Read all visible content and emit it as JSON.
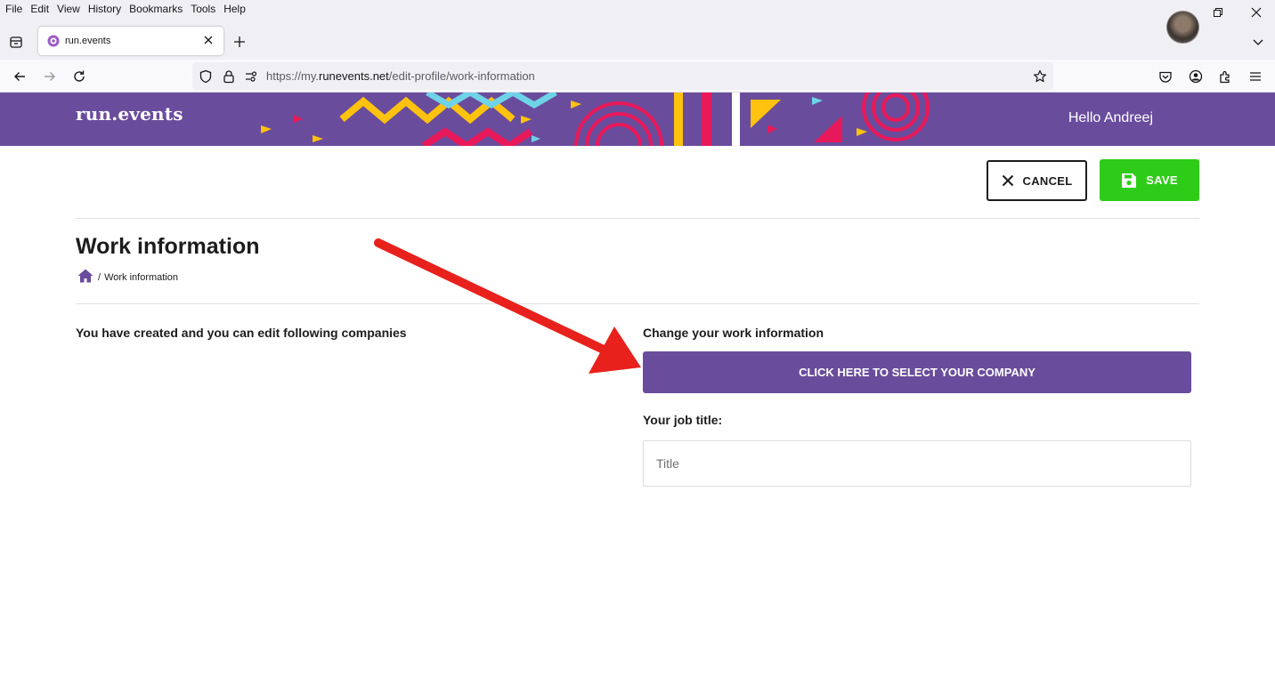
{
  "browser": {
    "menu": [
      "File",
      "Edit",
      "View",
      "History",
      "Bookmarks",
      "Tools",
      "Help"
    ],
    "tab_title": "run.events",
    "url_prefix": "https://my.",
    "url_host": "runevents.net",
    "url_path": "/edit-profile/work-information",
    "icons": [
      "tab-list-icon",
      "favicon-icon",
      "close-tab-icon",
      "new-tab-icon",
      "list-all-tabs-icon",
      "back-icon",
      "forward-icon",
      "reload-icon",
      "shield-icon",
      "lock-icon",
      "permissions-icon",
      "bookmark-star-icon",
      "pocket-icon",
      "account-icon",
      "extensions-icon",
      "app-menu-icon",
      "minimize-icon",
      "restore-icon",
      "close-window-icon"
    ]
  },
  "header": {
    "logo": "run.events",
    "greeting": "Hello Andreej",
    "colors": {
      "brand_purple": "#6a4c9c",
      "yellow": "#ffc20e",
      "pink": "#e8195a",
      "cyan": "#6fd3e8"
    }
  },
  "toolbar": {
    "cancel_label": "CANCEL",
    "save_label": "SAVE",
    "save_color": "#2ecc18"
  },
  "page": {
    "title": "Work information",
    "breadcrumb_separator": "/",
    "breadcrumb_current": "Work information"
  },
  "left": {
    "heading": "You have created and you can edit following companies"
  },
  "right": {
    "heading": "Change your work information",
    "select_company_label": "CLICK HERE TO SELECT YOUR COMPANY",
    "job_title_label": "Your job title:",
    "job_title_placeholder": "Title",
    "job_title_value": ""
  },
  "annotation": {
    "arrow_color": "#e8211c"
  }
}
